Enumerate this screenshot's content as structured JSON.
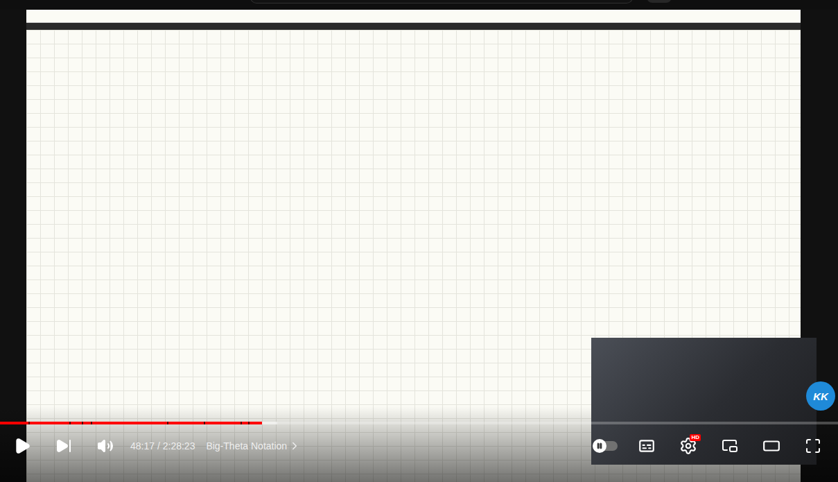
{
  "player": {
    "playing": false,
    "progress": {
      "level": 0.313,
      "buffered": 0.331,
      "chapter_breaks": [
        0.034,
        0.083,
        0.098,
        0.108,
        0.199,
        0.243,
        0.287,
        0.296
      ]
    },
    "time": "48:17 / 2:28:23",
    "chapter": "Big-Theta Notation",
    "autoplay": {
      "on": false
    },
    "settings_badge": "HD",
    "watermark": "KK"
  }
}
